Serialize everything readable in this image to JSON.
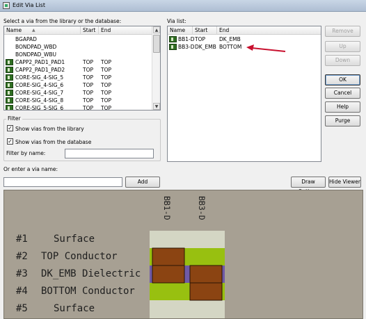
{
  "window": {
    "title": "Edit Via List"
  },
  "left_panel": {
    "label": "Select a via from the library or the database:",
    "columns": [
      "Name",
      "Start",
      "End"
    ],
    "rows": [
      {
        "name": "BGAPAD",
        "start": "",
        "end": "",
        "icon": ""
      },
      {
        "name": "BONDPAD_WBD",
        "start": "",
        "end": "",
        "icon": ""
      },
      {
        "name": "BONDPAD_WBU",
        "start": "",
        "end": "",
        "icon": ""
      },
      {
        "name": "CAPP2_PAD1_PAD1",
        "start": "TOP",
        "end": "TOP",
        "icon": "via-icon"
      },
      {
        "name": "CAPP2_PAD1_PAD2",
        "start": "TOP",
        "end": "TOP",
        "icon": "via-icon"
      },
      {
        "name": "CORE-SIG_4-SIG_5",
        "start": "TOP",
        "end": "TOP",
        "icon": "via-icon"
      },
      {
        "name": "CORE-SIG_4-SIG_6",
        "start": "TOP",
        "end": "TOP",
        "icon": "via-icon"
      },
      {
        "name": "CORE-SIG_4-SIG_7",
        "start": "TOP",
        "end": "TOP",
        "icon": "via-icon"
      },
      {
        "name": "CORE-SIG_4-SIG_8",
        "start": "TOP",
        "end": "TOP",
        "icon": "via-icon"
      },
      {
        "name": "CORE-SIG_5-SIG_6",
        "start": "TOP",
        "end": "TOP",
        "icon": "via-icon"
      }
    ]
  },
  "via_list": {
    "label": "Via list:",
    "columns": [
      "Name",
      "Start",
      "End"
    ],
    "rows": [
      {
        "name": "BB1-D",
        "start": "TOP",
        "end": "DK_EMB",
        "icon": "via-icon"
      },
      {
        "name": "BB3-D",
        "start": "DK_EMB",
        "end": "BOTTOM",
        "icon": "via-icon"
      }
    ]
  },
  "side_buttons": {
    "remove": "Remove",
    "up": "Up",
    "down": "Down",
    "ok": "OK",
    "cancel": "Cancel",
    "help": "Help",
    "purge": "Purge"
  },
  "filter": {
    "label": "Filter",
    "show_library": {
      "label": "Show vias from the library",
      "checked": true
    },
    "show_database": {
      "label": "Show vias from the database",
      "checked": true
    },
    "filter_by_name_label": "Filter by name:",
    "filter_by_name_value": ""
  },
  "via_name": {
    "label": "Or enter a via name:",
    "value": "",
    "add_button": "Add"
  },
  "viewer_buttons": {
    "draw_options": "Draw Options",
    "hide_viewer": "Hide Viewer"
  },
  "stackup": {
    "columns": [
      "BB1-D",
      "BB3-D"
    ],
    "layers": [
      {
        "num": "#1",
        "name": "Surface"
      },
      {
        "num": "#2",
        "name": "TOP Conductor"
      },
      {
        "num": "#3",
        "name": "DK_EMB Dielectric"
      },
      {
        "num": "#4",
        "name": "BOTTOM Conductor"
      },
      {
        "num": "#5",
        "name": "Surface"
      }
    ],
    "colors": {
      "background": "#a7a093",
      "surface": "#d4d6c4",
      "conductor": "#98c010",
      "dielectric": "#6f5aa6",
      "via_pad": "#8b4412",
      "annotation_arrow": "#c8102e"
    }
  }
}
